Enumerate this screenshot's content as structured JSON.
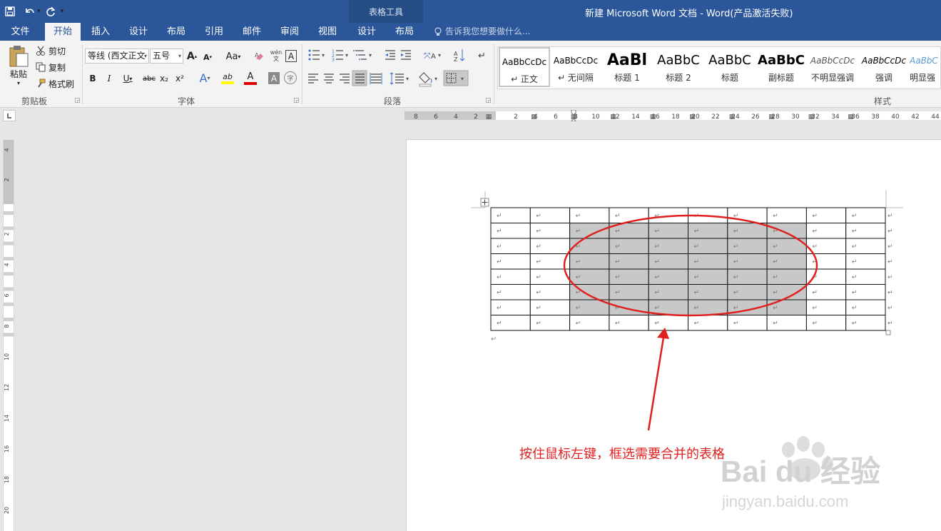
{
  "app": {
    "window_title": "新建 Microsoft Word 文档 - Word(产品激活失败)",
    "context_tab_group": "表格工具"
  },
  "tabs": [
    {
      "label": "文件"
    },
    {
      "label": "开始"
    },
    {
      "label": "插入"
    },
    {
      "label": "设计"
    },
    {
      "label": "布局"
    },
    {
      "label": "引用"
    },
    {
      "label": "邮件"
    },
    {
      "label": "审阅"
    },
    {
      "label": "视图"
    },
    {
      "label": "设计"
    },
    {
      "label": "布局"
    }
  ],
  "tell_me": {
    "placeholder": "告诉我您想要做什么..."
  },
  "clipboard": {
    "paste_label": "粘贴",
    "cut_label": "剪切",
    "copy_label": "复制",
    "format_painter_label": "格式刷",
    "group_label": "剪贴板"
  },
  "font": {
    "font_name": "等线 (西文正文",
    "font_size": "五号",
    "group_label": "字体",
    "bold": "B",
    "italic": "I",
    "underline": "U",
    "strike": "abc",
    "subscript": "x₂",
    "superscript": "x²",
    "grow": "A",
    "shrink": "A",
    "case": "Aa",
    "phonetic": "wén",
    "border_char": "A",
    "text_effect": "A",
    "highlight": "ab",
    "font_color": "A",
    "shading_char": "A",
    "enclose_char": "字"
  },
  "paragraph": {
    "group_label": "段落"
  },
  "styles": {
    "group_label": "样式",
    "items": [
      {
        "preview": "AaBbCcDc",
        "name": "↵ 正文"
      },
      {
        "preview": "AaBbCcDc",
        "name": "↵ 无间隔"
      },
      {
        "preview": "AaBl",
        "name": "标题 1"
      },
      {
        "preview": "AaBbC",
        "name": "标题 2"
      },
      {
        "preview": "AaBbC",
        "name": "标题"
      },
      {
        "preview": "AaBbC",
        "name": "副标题"
      },
      {
        "preview": "AaBbCcDc",
        "name": "不明显强调"
      },
      {
        "preview": "AaBbCcDc",
        "name": "强调"
      },
      {
        "preview": "AaBbC",
        "name": "明显强"
      }
    ]
  },
  "ruler": {
    "h_left_numbers": [
      "8",
      "6",
      "4",
      "2"
    ],
    "h_right_numbers": [
      "2",
      "4",
      "6",
      "8",
      "10",
      "12",
      "14",
      "16",
      "18",
      "20",
      "22",
      "24",
      "26",
      "28",
      "30",
      "32",
      "34",
      "36",
      "38",
      "40",
      "42",
      "44"
    ],
    "v_numbers": [
      "4",
      "2",
      "2",
      "4",
      "6",
      "8",
      "10",
      "12",
      "14",
      "16",
      "18",
      "20"
    ]
  },
  "table": {
    "rows": 8,
    "cols": 10,
    "cell_mark": "↵",
    "selected_rows": [
      1,
      6
    ],
    "selected_cols": [
      2,
      7
    ]
  },
  "annotation": {
    "text": "按住鼠标左键，框选需要合并的表格",
    "color": "#e0201f"
  },
  "watermark": {
    "brand": "Bai du 经验",
    "url": "jingyan.baidu.com"
  },
  "colors": {
    "ribbon_blue": "#2b579a",
    "ribbon_bg": "#f3f3f3",
    "selection_gray": "#c8c8c8",
    "highlight_yellow": "#ffff00",
    "font_red": "#e00000"
  }
}
